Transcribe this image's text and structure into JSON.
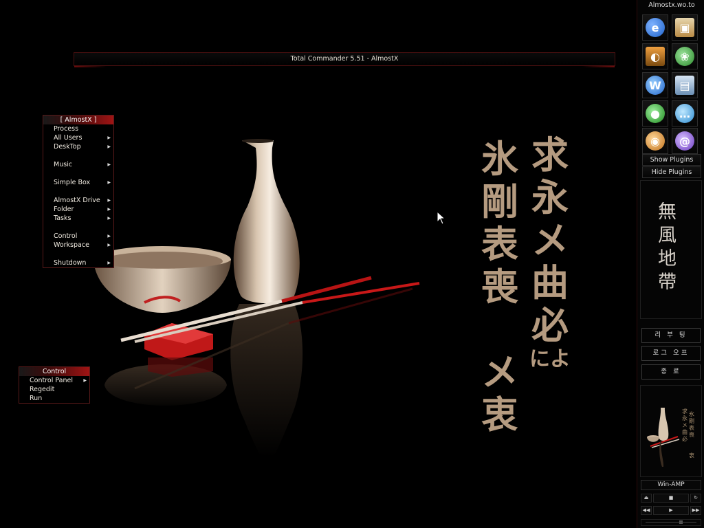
{
  "window": {
    "title": "Total Commander 5.51 - AlmostX"
  },
  "start_menu": {
    "header": "[  AlmostX  ]",
    "items": [
      {
        "label": "Process",
        "submenu": false
      },
      {
        "label": "All Users",
        "submenu": true
      },
      {
        "label": "DeskTop",
        "submenu": true
      },
      {
        "label": "Music",
        "submenu": true
      },
      {
        "label": "Simple Box",
        "submenu": true
      },
      {
        "label": "AlmostX Drive",
        "submenu": true
      },
      {
        "label": "Folder",
        "submenu": true
      },
      {
        "label": "Tasks",
        "submenu": true
      },
      {
        "label": "Control",
        "submenu": true
      },
      {
        "label": "Workspace",
        "submenu": true
      },
      {
        "label": "Shutdown",
        "submenu": true
      }
    ]
  },
  "control_menu": {
    "header": "Control",
    "items": [
      {
        "label": "Control Panel",
        "submenu": true
      },
      {
        "label": "Regedit",
        "submenu": false
      },
      {
        "label": "Run",
        "submenu": false
      }
    ]
  },
  "wallpaper": {
    "calligraphy_col1": [
      "求",
      "永",
      "メ",
      "曲",
      "必",
      "によ"
    ],
    "calligraphy_col2": [
      "氷",
      "剛",
      "表",
      "喪",
      "",
      "メ",
      "衷"
    ]
  },
  "dock": {
    "title": "Almostx.wo.to",
    "icons": [
      {
        "name": "internet-explorer-icon",
        "glyph": "e",
        "color": "#1f63c9"
      },
      {
        "name": "package-icon",
        "glyph": "▣",
        "color": "#c9a35a"
      },
      {
        "name": "media-player-icon",
        "glyph": "◐",
        "color": "#c87a1e"
      },
      {
        "name": "green-network-icon",
        "glyph": "❀",
        "color": "#3aa43a"
      },
      {
        "name": "w-app-icon",
        "glyph": "W",
        "color": "#2a7fd8"
      },
      {
        "name": "computer-icon",
        "glyph": "▤",
        "color": "#8aa8c8"
      },
      {
        "name": "green-robot-icon",
        "glyph": "●",
        "color": "#36b036"
      },
      {
        "name": "chat-icon",
        "glyph": "…",
        "color": "#3aa0d8"
      },
      {
        "name": "eye-icon",
        "glyph": "◉",
        "color": "#e8a038"
      },
      {
        "name": "mail-icon",
        "glyph": "@",
        "color": "#8a5ad0"
      }
    ],
    "show_plugins": "Show Plugins",
    "hide_plugins": "Hide Plugins",
    "calligraphy": [
      "無",
      "風",
      "地",
      "帶"
    ],
    "reboot": "리 부 팅",
    "logoff": "로그 오프",
    "exit": "종    료",
    "winamp": "Win-AMP",
    "winamp_controls": {
      "eject": "⏏",
      "stop": "■",
      "repeat": "↻",
      "prev": "◀◀",
      "play": "▶",
      "next": "▶▶"
    }
  }
}
